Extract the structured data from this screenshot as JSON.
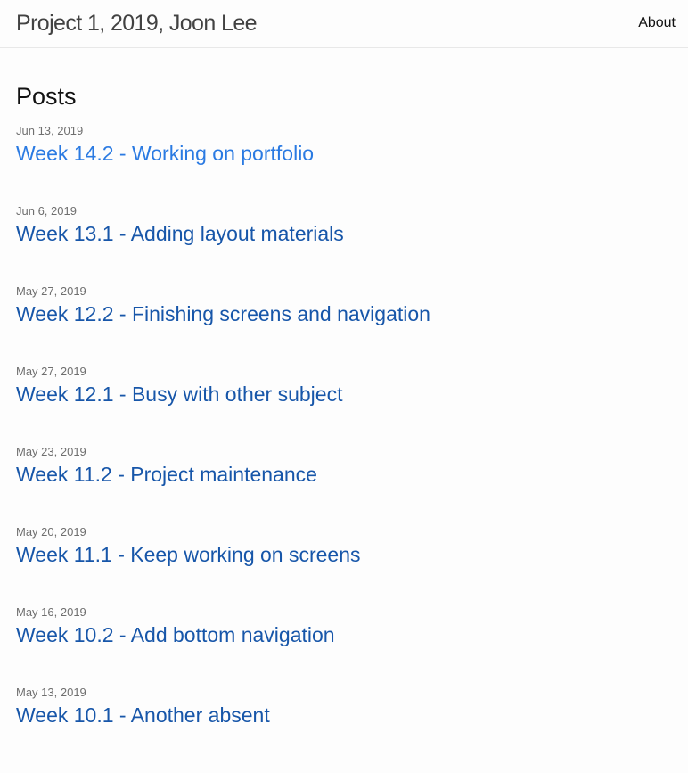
{
  "header": {
    "site_title": "Project 1, 2019, Joon Lee",
    "nav": [
      {
        "label": "About"
      }
    ]
  },
  "main": {
    "heading": "Posts",
    "posts": [
      {
        "date": "Jun 13, 2019",
        "title": "Week 14.2 - Working on portfolio",
        "visited": false
      },
      {
        "date": "Jun 6, 2019",
        "title": "Week 13.1 - Adding layout materials",
        "visited": true
      },
      {
        "date": "May 27, 2019",
        "title": "Week 12.2 - Finishing screens and navigation",
        "visited": true
      },
      {
        "date": "May 27, 2019",
        "title": "Week 12.1 - Busy with other subject",
        "visited": true
      },
      {
        "date": "May 23, 2019",
        "title": "Week 11.2 - Project maintenance",
        "visited": true
      },
      {
        "date": "May 20, 2019",
        "title": "Week 11.1 - Keep working on screens",
        "visited": true
      },
      {
        "date": "May 16, 2019",
        "title": "Week 10.2 - Add bottom navigation",
        "visited": true
      },
      {
        "date": "May 13, 2019",
        "title": "Week 10.1 - Another absent",
        "visited": true
      }
    ]
  },
  "colors": {
    "link": "#2a7ae2",
    "link_visited": "#1756a9",
    "meta": "#6f6f6f",
    "title": "#424242"
  }
}
